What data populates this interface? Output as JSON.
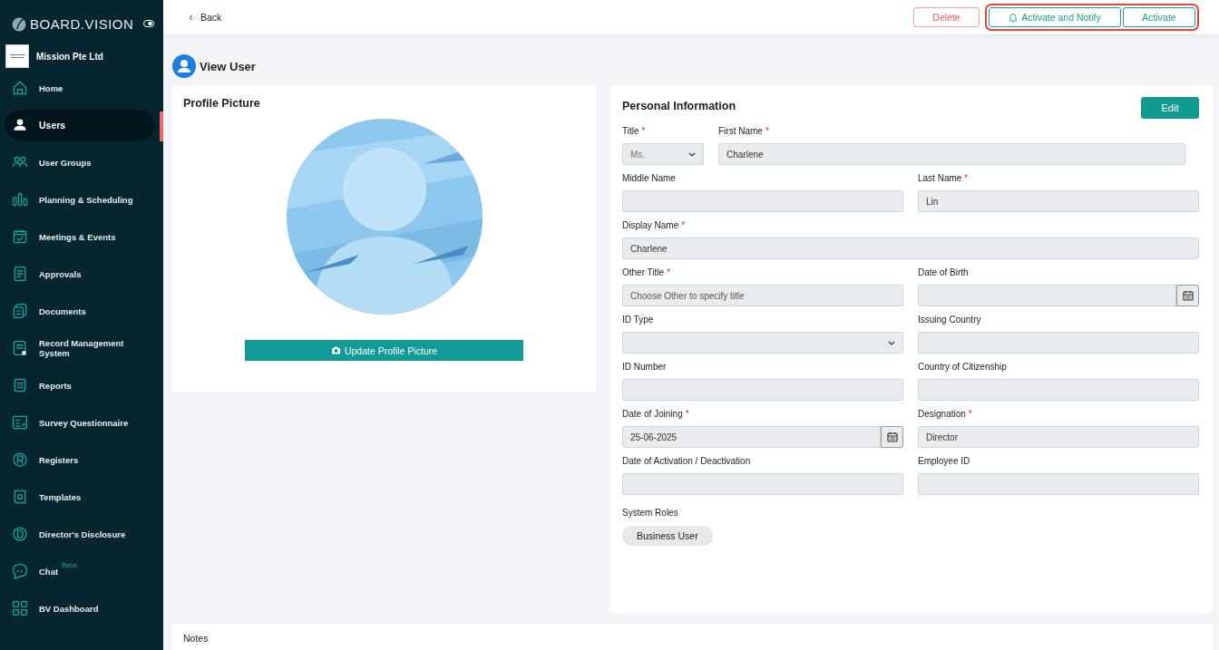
{
  "brand": {
    "name": "BOARD.VISION"
  },
  "organization": {
    "name": "Mission Pte Ltd"
  },
  "sidebar": {
    "items": [
      {
        "label": "Home",
        "selected": false
      },
      {
        "label": "Users",
        "selected": true
      },
      {
        "label": "User Groups",
        "selected": false
      },
      {
        "label": "Planning & Scheduling",
        "selected": false
      },
      {
        "label": "Meetings & Events",
        "selected": false
      },
      {
        "label": "Approvals",
        "selected": false
      },
      {
        "label": "Documents",
        "selected": false
      },
      {
        "label": "Record Management System",
        "selected": false
      },
      {
        "label": "Reports",
        "selected": false
      },
      {
        "label": "Survey Questionnaire",
        "selected": false
      },
      {
        "label": "Registers",
        "selected": false
      },
      {
        "label": "Templates",
        "selected": false
      },
      {
        "label": "Director's Disclosure",
        "selected": false
      },
      {
        "label": "Chat",
        "badge": "Beta",
        "selected": false
      },
      {
        "label": "BV Dashboard",
        "selected": false
      }
    ]
  },
  "topbar": {
    "back": "Back",
    "actions": [
      {
        "label": "Delete",
        "kind": "danger",
        "highlighted": false
      },
      {
        "label": "Activate and Notify",
        "kind": "notify",
        "highlighted": true
      },
      {
        "label": "Activate",
        "kind": "primary",
        "highlighted": true
      }
    ]
  },
  "page": {
    "title": "View User"
  },
  "profile_card": {
    "title": "Profile Picture",
    "button": "Update Profile Picture"
  },
  "personal_info": {
    "title": "Personal Information",
    "edit_button": "Edit",
    "rows": [
      {
        "kind": "title",
        "fields": [
          {
            "label": "Title",
            "required_mark": "*",
            "kind": "select",
            "value": "Ms."
          },
          {
            "label": "First Name",
            "required_mark": "*",
            "kind": "text",
            "value": "Charlene"
          }
        ]
      },
      {
        "kind": "pair",
        "fields": [
          {
            "label": "Middle Name",
            "kind": "text"
          },
          {
            "label": "Last Name",
            "required_mark": "*",
            "kind": "text",
            "value": "Lin"
          }
        ]
      },
      {
        "kind": "single",
        "fields": [
          {
            "label": "Display Name",
            "required_mark": "*",
            "kind": "text",
            "value": "Charlene"
          }
        ]
      },
      {
        "kind": "pair",
        "fields": [
          {
            "label": "Other Title",
            "required_mark": "*",
            "kind": "text",
            "placeholder": "Choose Other to specify title"
          },
          {
            "label": "Date of Birth",
            "kind": "date"
          }
        ]
      },
      {
        "kind": "pair",
        "fields": [
          {
            "label": "ID Type",
            "kind": "select"
          },
          {
            "label": "Issuing Country",
            "kind": "text"
          }
        ]
      },
      {
        "kind": "pair",
        "fields": [
          {
            "label": "ID Number",
            "kind": "text"
          },
          {
            "label": "Country of Citizenship",
            "kind": "text"
          }
        ]
      },
      {
        "kind": "pair",
        "fields": [
          {
            "label": "Date of Joining",
            "required_mark": "*",
            "kind": "date",
            "value": "25-06-2025"
          },
          {
            "label": "Designation",
            "required_mark": "*",
            "kind": "text",
            "value": "Director"
          }
        ]
      },
      {
        "kind": "pair",
        "fields": [
          {
            "label": "Date of Activation / Deactivation",
            "kind": "text"
          },
          {
            "label": "Employee ID",
            "kind": "text"
          }
        ]
      }
    ],
    "system_roles": {
      "label": "System Roles",
      "roles": [
        "Business User"
      ]
    }
  },
  "notes": {
    "title": "Notes"
  }
}
